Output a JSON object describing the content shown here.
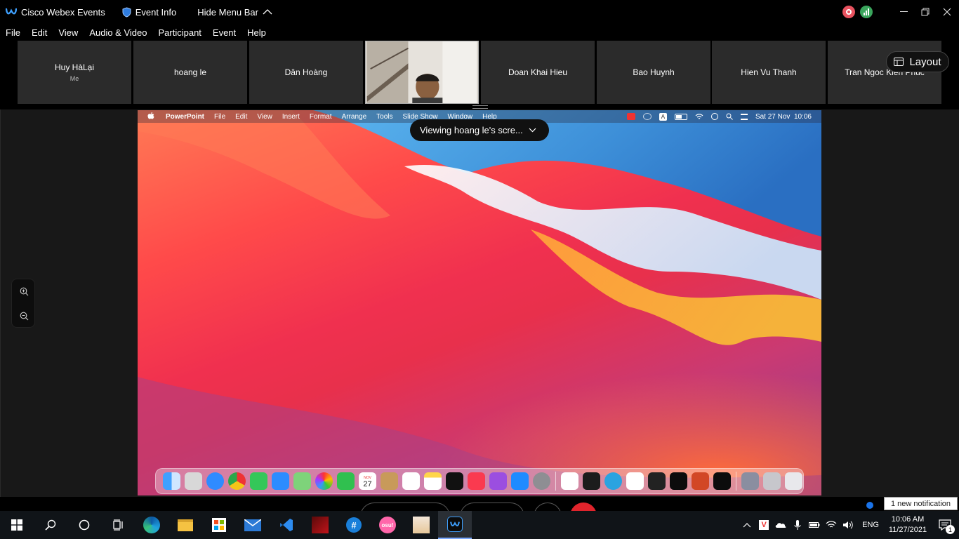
{
  "titlebar": {
    "app_name": "Cisco Webex Events",
    "event_info": "Event Info",
    "hide_menu": "Hide Menu Bar"
  },
  "menu": [
    "File",
    "Edit",
    "View",
    "Audio & Video",
    "Participant",
    "Event",
    "Help"
  ],
  "participants": [
    {
      "name": "Huy HàLại",
      "sub": "Me"
    },
    {
      "name": "hoang le",
      "sub": ""
    },
    {
      "name": "Dân Hoàng",
      "sub": ""
    },
    {
      "name": "",
      "sub": "",
      "video": true
    },
    {
      "name": "Doan Khai Hieu",
      "sub": ""
    },
    {
      "name": "Bao Huynh",
      "sub": ""
    },
    {
      "name": "Hien Vu Thanh",
      "sub": ""
    },
    {
      "name": "Tran Ngoc Kien Phuc",
      "sub": ""
    }
  ],
  "layout_button": "Layout",
  "viewing_banner": "Viewing hoang le's scre...",
  "mac": {
    "menu": [
      "PowerPoint",
      "File",
      "Edit",
      "View",
      "Insert",
      "Format",
      "Arrange",
      "Tools",
      "Slide Show",
      "Window",
      "Help"
    ],
    "clock": "Sat 27 Nov  10:06",
    "calendar_day": "27",
    "calendar_month": "NOV"
  },
  "notification": "1 new notification",
  "taskbar": {
    "lang": "ENG",
    "time": "10:06 AM",
    "date": "11/27/2021",
    "notif_count": "1"
  },
  "colors": {
    "accent": "#1a73e8",
    "tile_bg": "#2b2b2b",
    "end_call": "#e0242c"
  }
}
